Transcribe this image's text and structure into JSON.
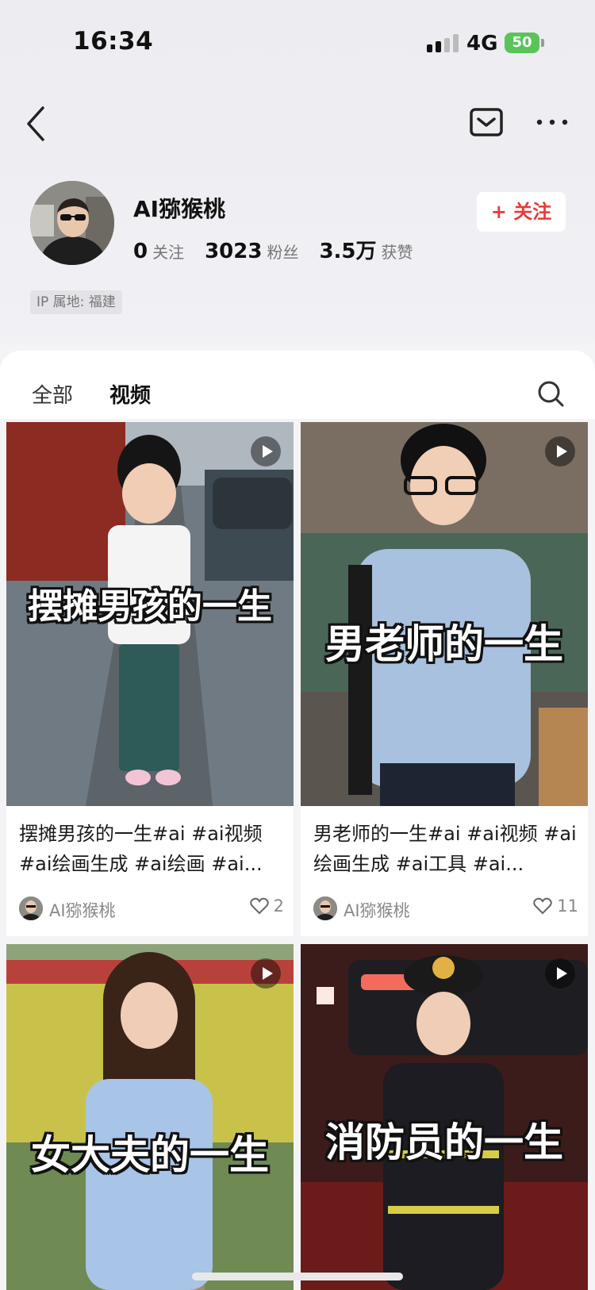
{
  "status_bar": {
    "time": "16:34",
    "network": "4G",
    "battery": "50"
  },
  "profile": {
    "name": "AI猕猴桃",
    "follow_button": "+ 关注",
    "ip_location": "IP 属地: 福建",
    "stats": [
      {
        "value": "0",
        "label": "关注"
      },
      {
        "value": "3023",
        "label": "粉丝"
      },
      {
        "value": "3.5万",
        "label": "获赞"
      }
    ]
  },
  "tabs": [
    {
      "label": "全部",
      "active": false
    },
    {
      "label": "视频",
      "active": true
    }
  ],
  "videos": [
    {
      "caption": "摆摊男孩的一生",
      "title": "摆摊男孩的一生#ai #ai视频 #ai绘画生成 #ai绘画 #ai...",
      "author": "AI猕猴桃",
      "likes": "2"
    },
    {
      "caption": "男老师的一生",
      "title": "男老师的一生#ai #ai视频 #ai绘画生成 #ai工具 #ai...",
      "author": "AI猕猴桃",
      "likes": "11"
    },
    {
      "caption": "女大夫的一生",
      "title": "",
      "author": "",
      "likes": ""
    },
    {
      "caption": "消防员的一生",
      "title": "",
      "author": "",
      "likes": ""
    }
  ],
  "colors": {
    "accent": "#e83a3a",
    "battery": "#5ac35a",
    "sheet": "#f4f4f6"
  },
  "icons": [
    "back-icon",
    "mail-icon",
    "more-icon",
    "search-icon",
    "play-icon",
    "heart-icon"
  ]
}
